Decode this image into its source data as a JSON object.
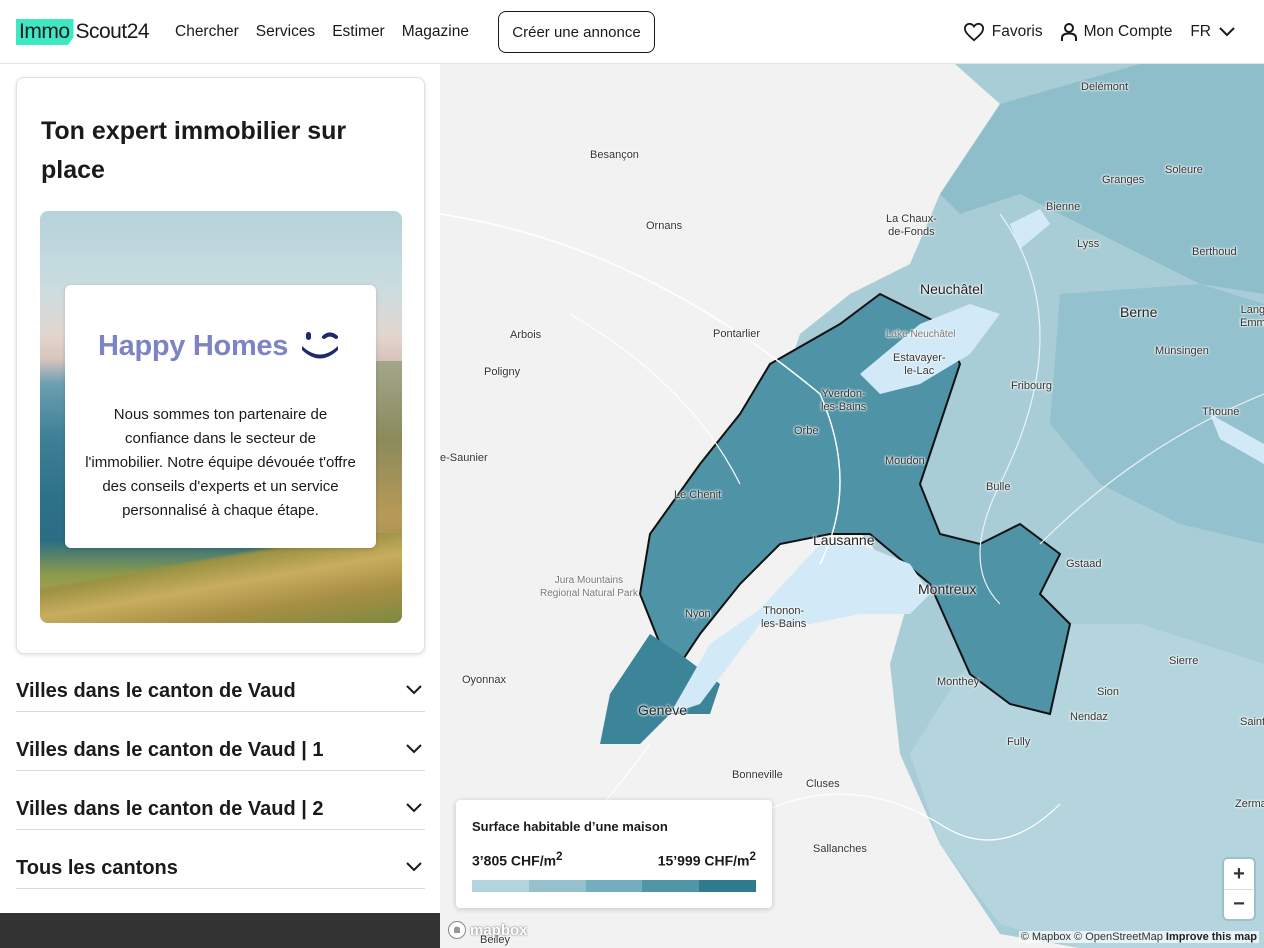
{
  "header": {
    "logo_part1": "Immo",
    "logo_part2": "Scout24",
    "nav": [
      "Chercher",
      "Services",
      "Estimer",
      "Magazine"
    ],
    "create_button": "Créer une annonce",
    "favorites": "Favoris",
    "account": "Mon Compte",
    "language": "FR"
  },
  "card": {
    "title": "Ton expert immobilier sur place",
    "brand": "Happy Homes",
    "text": "Nous sommes ton partenaire de confiance dans le secteur de l'immobilier. Notre équipe dévouée t'offre des conseils d'experts et un service personnalisé à chaque étape."
  },
  "accordions": [
    "Villes dans le canton de Vaud",
    "Villes dans le canton de Vaud | 1",
    "Villes dans le canton de Vaud | 2",
    "Tous les cantons"
  ],
  "map": {
    "places": {
      "delemont": "Delémont",
      "besancon": "Besançon",
      "granges": "Granges",
      "soleure": "Soleure",
      "bienne": "Bienne",
      "lachaux1": "La Chaux-",
      "lachaux2": "de-Fonds",
      "ornans": "Ornans",
      "lyss": "Lyss",
      "berthoud": "Berthoud",
      "neuchatel": "Neuchâtel",
      "berne": "Berne",
      "lang1": "Lang",
      "lang2": "Emm",
      "lakeneuch": "Lake Neuchâtel",
      "arbois": "Arbois",
      "pontarlier": "Pontarlier",
      "estavayer1": "Estavayer-",
      "estavayer2": "le-Lac",
      "munsingen": "Münsingen",
      "poligny": "Poligny",
      "yverdon1": "Yverdon-",
      "yverdon2": "les-Bains",
      "fribourg": "Fribourg",
      "thoune": "Thoune",
      "orbe": "Orbe",
      "saunier": "e-Saunier",
      "moudon": "Moudon",
      "bulle": "Bulle",
      "lechenit": "Le Chenit",
      "lausanne": "Lausanne",
      "gstaad": "Gstaad",
      "jura1": "Jura Mountains",
      "jura2": "Regional Natural Park",
      "montreux": "Montreux",
      "nyon": "Nyon",
      "thonon1": "Thonon-",
      "thonon2": "les-Bains",
      "sierre": "Sierre",
      "oyonnax": "Oyonnax",
      "monthey": "Monthey",
      "sion": "Sion",
      "nendaz": "Nendaz",
      "geneve": "Genève",
      "saint": "Saint",
      "fully": "Fully",
      "bonneville": "Bonneville",
      "cluses": "Cluses",
      "zerma": "Zerma",
      "sallanches": "Sallanches",
      "belley": "Belley"
    },
    "legend": {
      "title": "Surface habitable d’une maison",
      "min": "3’805 CHF/m",
      "max": "15’999 CHF/m",
      "unit_sup": "2",
      "colors": [
        "#b3d4dc",
        "#94c1cc",
        "#72aebd",
        "#4f96a8",
        "#2e7a8f"
      ]
    },
    "zoom_in": "+",
    "zoom_out": "−",
    "mapbox": "mapbox",
    "attribution_1": "© Mapbox © OpenStreetMap",
    "attribution_2": "Improve this map"
  }
}
